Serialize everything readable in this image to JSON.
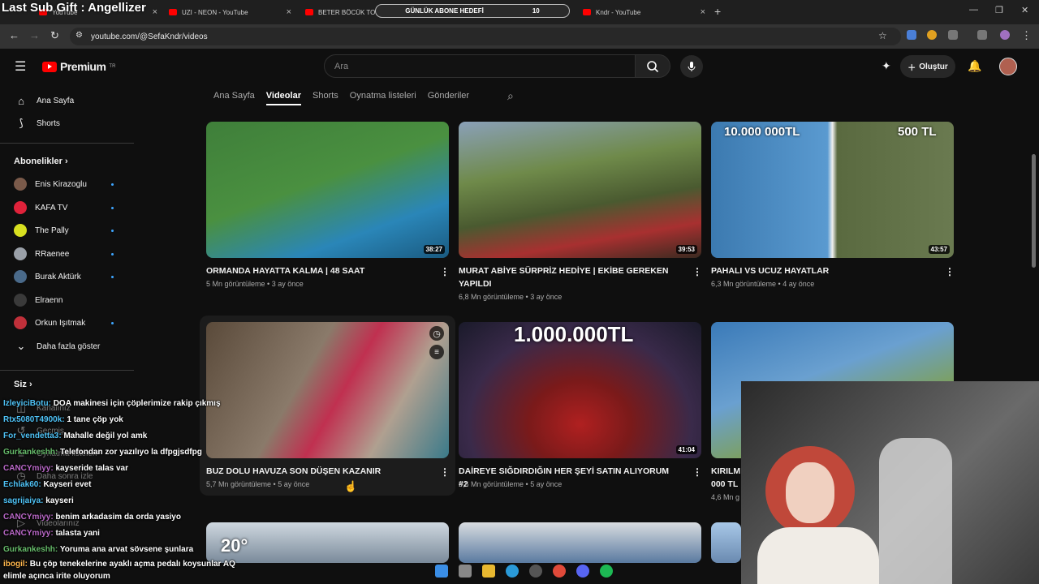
{
  "overlay": {
    "sub_gift": "Last Sub Gift : Angellizer"
  },
  "browser": {
    "tabs": [
      {
        "label": "YouTube"
      },
      {
        "label": "UZI - NEON - YouTube"
      },
      {
        "label": "BETER BÖCÜK TOPR..."
      },
      {
        "label": "YouTube"
      },
      {
        "label": "Kndr - YouTube"
      }
    ],
    "goal_label": "GÜNLÜK ABONE HEDEFİ",
    "goal_count": "10",
    "url": "youtube.com/@SefaKndr/videos",
    "new_tab": "+"
  },
  "youtube": {
    "brand": "Premium",
    "brand_sup": "TR",
    "search_placeholder": "Ara",
    "create_label": "Oluştur",
    "sidebar": {
      "home": "Ana Sayfa",
      "shorts": "Shorts",
      "subs_header": "Abonelikler",
      "subscriptions": [
        {
          "name": "Enis Kirazoglu",
          "color": "#7a5a4a"
        },
        {
          "name": "KAFA TV",
          "color": "#e0223a"
        },
        {
          "name": "The Pally",
          "color": "#d8e020"
        },
        {
          "name": "RRaenee",
          "color": "#9aa0a8"
        },
        {
          "name": "Burak Aktürk",
          "color": "#4a6a8a"
        },
        {
          "name": "Elraenn",
          "color": "#3a3a3a"
        },
        {
          "name": "Orkun Işıtmak",
          "color": "#c0303a"
        }
      ],
      "show_more": "Daha fazla göster",
      "you_header": "Siz",
      "you_items": [
        "Kanalınız",
        "Geçmiş",
        "Oynatma listeleri",
        "Daha sonra izle",
        "Videolarınız"
      ]
    },
    "channel_tabs": [
      "Ana Sayfa",
      "Videolar",
      "Shorts",
      "Oynatma listeleri",
      "Gönderiler"
    ],
    "active_tab": "Videolar",
    "videos": [
      {
        "title": "ORMANDA HAYATTA KALMA | 48 SAAT",
        "views": "5 Mn görüntüleme",
        "age": "3 ay önce",
        "duration": "38:27",
        "c1": "#3f7f3a",
        "c2": "#2a86b8"
      },
      {
        "title": "MURAT ABİYE SÜRPRİZ HEDİYE | EKİBE GEREKEN YAPILDI",
        "views": "6,8 Mn görüntüleme",
        "age": "3 ay önce",
        "duration": "39:53",
        "c1": "#6f8a4a",
        "c2": "#a83030"
      },
      {
        "title": "PAHALI VS UCUZ HAYATLAR",
        "views": "6,3 Mn görüntüleme",
        "age": "4 ay önce",
        "duration": "43:57",
        "c1": "#3c7ab0",
        "c2": "#5a6a40",
        "overlay_left": "10.000 000TL",
        "overlay_right": "500 TL"
      },
      {
        "title": "BUZ DOLU HAVUZA SON DÜŞEN KAZANIR",
        "views": "5,7 Mn görüntüleme",
        "age": "5 ay önce",
        "duration": "",
        "c1": "#5a4a3a",
        "c2": "#b0a090"
      },
      {
        "title": "DAİREYE SIĞDIRDIĞIN HER ŞEYİ SATIN ALIYORUM #2",
        "views": "5,6 Mn görüntüleme",
        "age": "5 ay önce",
        "duration": "41:04",
        "c1": "#3a2a4a",
        "c2": "#b02020",
        "overlay_top": "1.000.000TL"
      },
      {
        "title": "KIRILM 000 TL",
        "views": "4,6 Mn g",
        "age": "",
        "duration": "",
        "c1": "#3a7ab8",
        "c2": "#7fa050"
      }
    ],
    "row3": [
      "20°"
    ]
  },
  "chat": [
    {
      "user": "IzleyiciBotu:",
      "msg": "DOA makinesi için çöplerimize rakip çıkmış",
      "color": "#4fc3f7"
    },
    {
      "user": "Rtx5080T4900k:",
      "msg": "1 tane çöp yok",
      "color": "#4fc3f7"
    },
    {
      "user": "For_vendetta3:",
      "msg": "Mahalle değil yol amk",
      "color": "#4fc3f7"
    },
    {
      "user": "Gurkankeshh:",
      "msg": "Telefondan zor yazılıyo la dfpgjsdfpg",
      "color": "#66bb6a"
    },
    {
      "user": "CANCYmiyy:",
      "msg": "kayseride talas var",
      "color": "#ba68c8"
    },
    {
      "user": "Echlak60:",
      "msg": "Kayseri evet",
      "color": "#4fc3f7"
    },
    {
      "user": "sagrijaiya:",
      "msg": "kayseri",
      "color": "#4fc3f7"
    },
    {
      "user": "CANCYmiyy:",
      "msg": "benim arkadasim da orda yasiyo",
      "color": "#ba68c8"
    },
    {
      "user": "CANCYmiyy:",
      "msg": "talasta yani",
      "color": "#ba68c8"
    },
    {
      "user": "Gurkankeshh:",
      "msg": "Yoruma ana arvat sövsene şunlara",
      "color": "#66bb6a"
    },
    {
      "user": "ibogil:",
      "msg": "Bu çöp tenekelerine ayaklı açma pedalı koysunlar AQ",
      "color": "#ffb74d"
    },
    {
      "user": "",
      "msg": "elimle açınca irite oluyorum",
      "color": "#ffffff"
    }
  ]
}
